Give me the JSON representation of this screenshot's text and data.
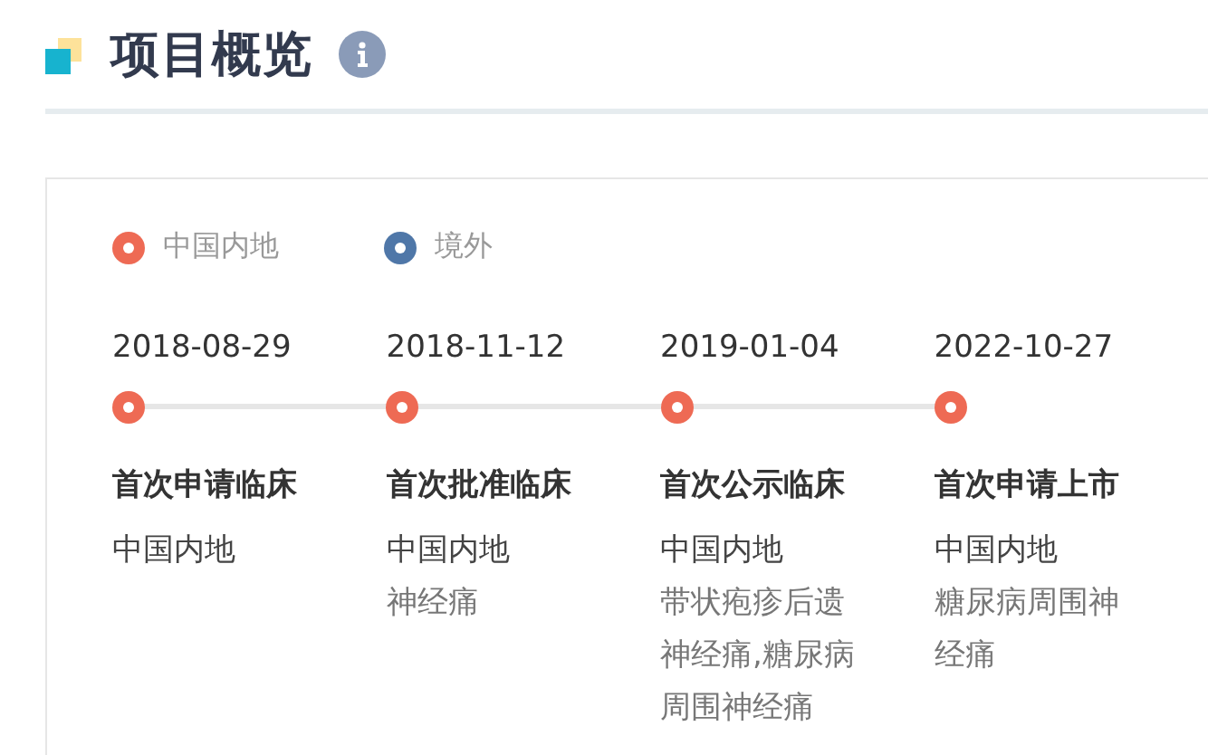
{
  "section": {
    "title": "项目概览"
  },
  "legend": [
    {
      "label": "中国内地",
      "color": "#ee6a54"
    },
    {
      "label": "境外",
      "color": "#4f77a8"
    }
  ],
  "events": [
    {
      "date": "2018-08-29",
      "title": "首次申请临床",
      "region": "中国内地",
      "color": "#ee6a54"
    },
    {
      "date": "2018-11-12",
      "title": "首次批准临床",
      "region": "中国内地",
      "indication": "神经痛",
      "color": "#ee6a54"
    },
    {
      "date": "2019-01-04",
      "title": "首次公示临床",
      "region": "中国内地",
      "indication": "带状疱疹后遗神经痛,糖尿病周围神经痛",
      "color": "#ee6a54"
    },
    {
      "date": "2022-10-27",
      "title": "首次申请上市",
      "region": "中国内地",
      "indication": "糖尿病周围神经痛",
      "color": "#ee6a54"
    }
  ]
}
